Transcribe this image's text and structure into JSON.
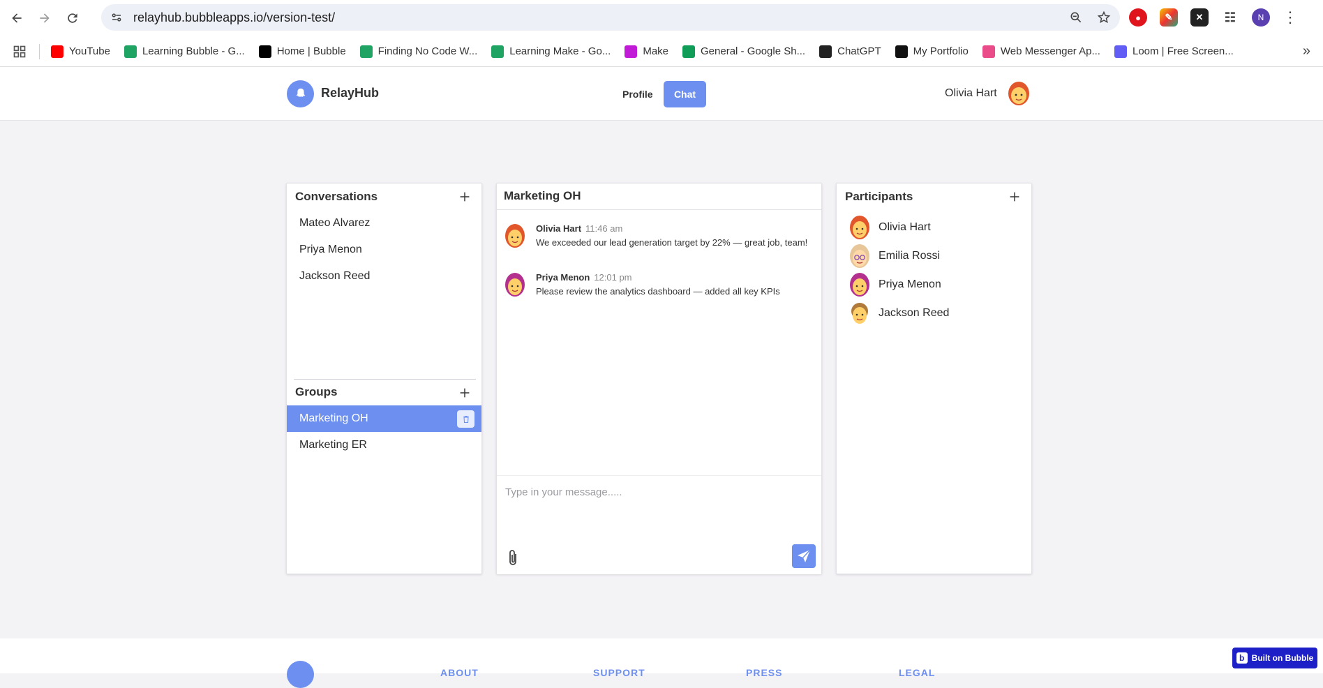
{
  "browser": {
    "url": "relayhub.bubbleapps.io/version-test/",
    "profile_initial": "N",
    "bookmarks": [
      {
        "label": "YouTube",
        "icon": "youtube-icon",
        "color": "#ff0000"
      },
      {
        "label": "Learning Bubble - G...",
        "icon": "google-drive-icon",
        "color": "#1fa463"
      },
      {
        "label": "Home | Bubble",
        "icon": "bubble-icon",
        "color": "#000000"
      },
      {
        "label": "Finding No Code W...",
        "icon": "google-drive-icon",
        "color": "#1fa463"
      },
      {
        "label": "Learning Make - Go...",
        "icon": "google-drive-icon",
        "color": "#1fa463"
      },
      {
        "label": "Make",
        "icon": "make-icon",
        "color": "#c21bd8"
      },
      {
        "label": "General - Google Sh...",
        "icon": "google-sheets-icon",
        "color": "#0f9d58"
      },
      {
        "label": "ChatGPT",
        "icon": "chatgpt-icon",
        "color": "#222222"
      },
      {
        "label": "My Portfolio",
        "icon": "notion-icon",
        "color": "#111111"
      },
      {
        "label": "Web Messenger Ap...",
        "icon": "dribbble-icon",
        "color": "#ea4c89"
      },
      {
        "label": "Loom | Free Screen...",
        "icon": "loom-icon",
        "color": "#625df5"
      }
    ]
  },
  "header": {
    "app_name": "RelayHub",
    "nav": {
      "profile": "Profile",
      "chat": "Chat"
    },
    "user_name": "Olivia Hart"
  },
  "conversations": {
    "title": "Conversations",
    "items": [
      "Mateo Alvarez",
      "Priya Menon",
      "Jackson Reed"
    ]
  },
  "groups": {
    "title": "Groups",
    "items": [
      {
        "label": "Marketing OH",
        "active": true
      },
      {
        "label": "Marketing ER",
        "active": false
      }
    ]
  },
  "chat": {
    "title": "Marketing OH",
    "messages": [
      {
        "author": "Olivia Hart",
        "time": "11:46 am",
        "text": "We exceeded our lead generation target by 22% — great job, team!"
      },
      {
        "author": "Priya Menon",
        "time": "12:01 pm",
        "text": "Please review the analytics dashboard — added all key KPIs"
      }
    ],
    "composer_placeholder": "Type in your message....."
  },
  "participants": {
    "title": "Participants",
    "items": [
      "Olivia Hart",
      "Emilia Rossi",
      "Priya Menon",
      "Jackson Reed"
    ]
  },
  "footer": {
    "links": [
      "ABOUT",
      "SUPPORT",
      "PRESS",
      "LEGAL"
    ],
    "badge": "Built on Bubble"
  },
  "colors": {
    "accent": "#6c8ff0",
    "badge": "#1d1fc7"
  }
}
